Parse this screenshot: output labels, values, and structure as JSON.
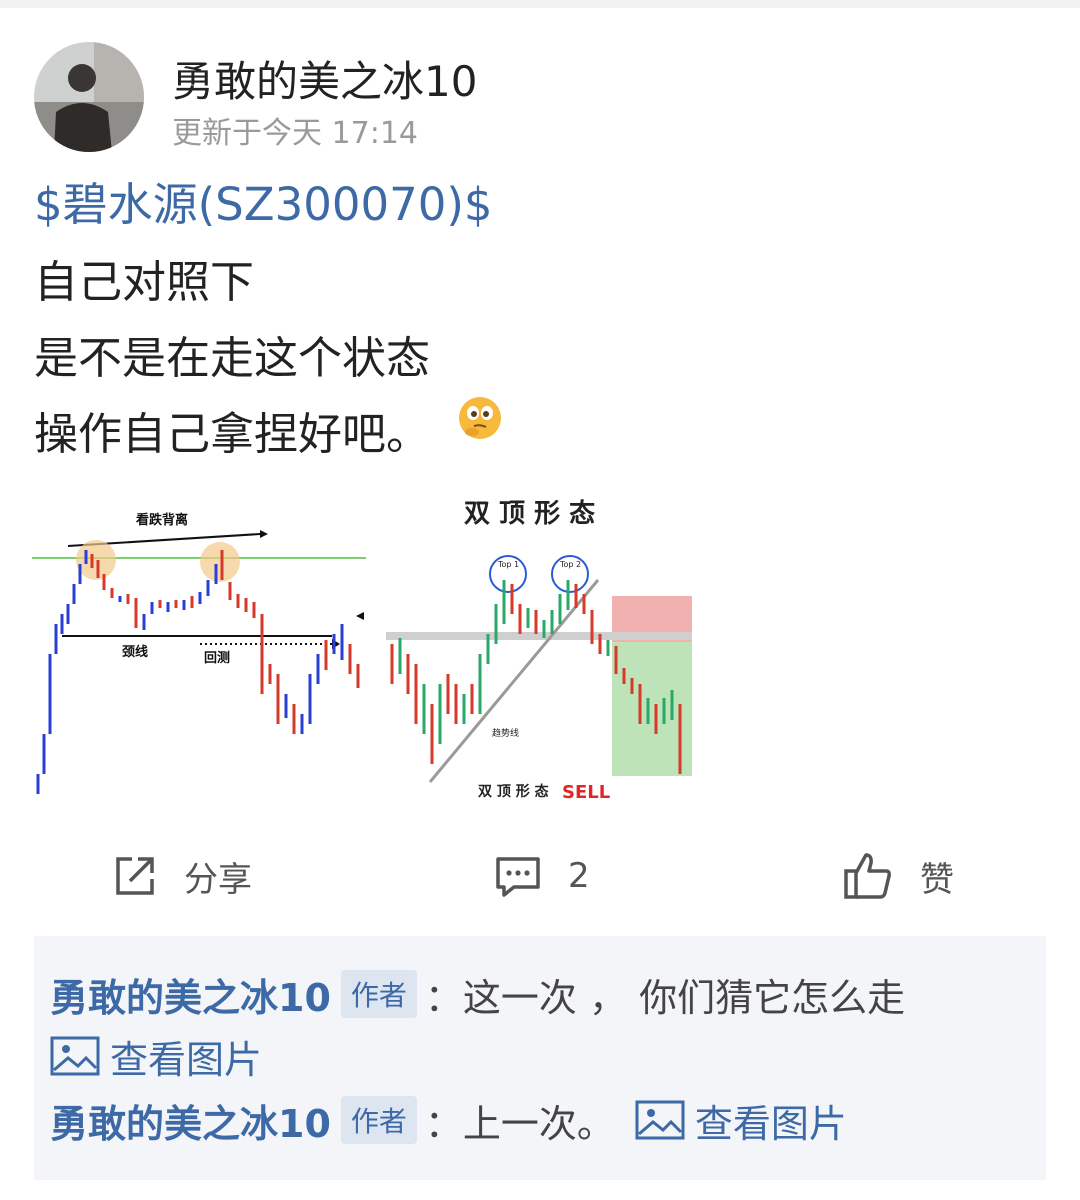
{
  "post": {
    "author": "勇敢的美之冰10",
    "time": "更新于今天 17:14",
    "stock_tag": "$碧水源(SZ300070)$",
    "lines": [
      "自己对照下",
      "是不是在走这个状态",
      "操作自己拿捏好吧。"
    ],
    "emoji": "thinking-face-icon"
  },
  "images": {
    "left": {
      "top_label": "看跌背离",
      "neck_label": "颈线",
      "retest_label": "回测"
    },
    "right": {
      "title": "双 顶 形 态",
      "top1": "Top 1",
      "top2": "Top 2",
      "trend_label": "趋势线",
      "caption": "双 顶 形 态",
      "sell": "SELL"
    }
  },
  "actions": {
    "share_label": "分享",
    "comment_count": "2",
    "like_label": "赞"
  },
  "comments": [
    {
      "user": "勇敢的美之冰10",
      "badge": "作者",
      "text": "：这一次 ， 你们猜它怎么走"
    },
    {
      "link": "查看图片"
    },
    {
      "user": "勇敢的美之冰10",
      "badge": "作者",
      "text": "：上一次。",
      "link": "查看图片"
    }
  ],
  "colors": {
    "link_blue": "#3d6aa6",
    "time_gray": "#9a9a9a",
    "comments_bg": "#f4f5f8"
  }
}
